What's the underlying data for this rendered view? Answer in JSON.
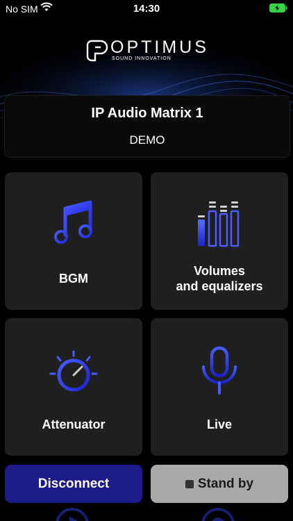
{
  "status_bar": {
    "carrier": "No SIM",
    "time": "14:30",
    "battery_charging": true
  },
  "logo": {
    "brand": "OPTIMUS",
    "tagline": "SOUND INNOVATION"
  },
  "device": {
    "name": "IP Audio Matrix 1",
    "mode": "DEMO"
  },
  "tiles": [
    {
      "label": "BGM",
      "icon": "music-note-icon"
    },
    {
      "label_line1": "Volumes",
      "label_line2": "and equalizers",
      "icon": "equalizer-icon"
    },
    {
      "label": "Attenuator",
      "icon": "knob-icon"
    },
    {
      "label": "Live",
      "icon": "microphone-icon"
    }
  ],
  "actions": {
    "disconnect_label": "Disconnect",
    "standby_label": "Stand by"
  },
  "colors": {
    "accent": "#2f3cff",
    "tile_bg": "#1f1f1f",
    "disconnect_bg": "#1d1a8a",
    "standby_bg": "#a9a9a9"
  }
}
